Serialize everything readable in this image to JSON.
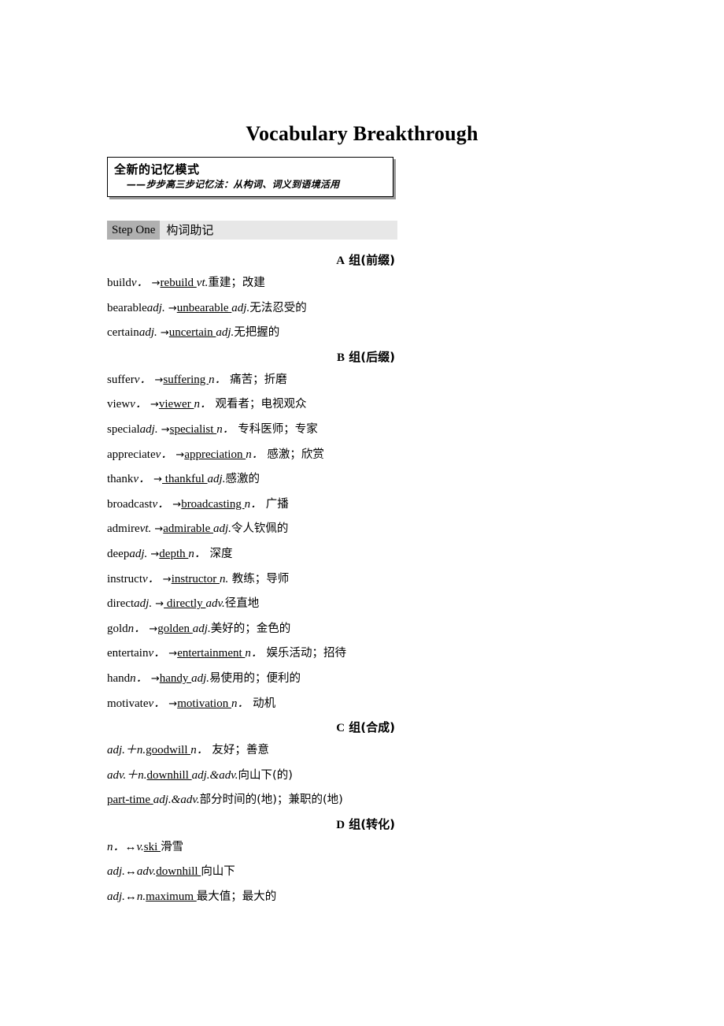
{
  "document": {
    "title": "Vocabulary Breakthrough"
  },
  "callout": {
    "title": "全新的记忆模式",
    "subtitle": "——步步高三步记忆法：从构词、词义到语境活用"
  },
  "step_bar": {
    "badge": "Step One",
    "label": "构词助记"
  },
  "groups": [
    {
      "heading_letter": "A",
      "heading_text": " 组(前缀)",
      "entries": [
        {
          "base": "build",
          "base_pos": "v．",
          "arrow": "→",
          "derived": "rebuild ",
          "derived_pos": "vt.",
          "meaning": "重建；改建"
        },
        {
          "base": "bearable",
          "base_pos": "adj.",
          "arrow": "→",
          "derived": "unbearable ",
          "derived_pos": "adj.",
          "meaning": "无法忍受的"
        },
        {
          "base": "certain",
          "base_pos": "adj.",
          "arrow": "→",
          "derived": "uncertain ",
          "derived_pos": "adj.",
          "meaning": "无把握的"
        }
      ]
    },
    {
      "heading_letter": "B",
      "heading_text": "  组(后缀)",
      "entries": [
        {
          "base": "suffer",
          "base_pos": "v．",
          "arrow": "→",
          "derived": "suffering ",
          "derived_pos": "n．",
          "meaning": " 痛苦；折磨"
        },
        {
          "base": "view",
          "base_pos": "v．",
          "arrow": "→",
          "derived": "viewer ",
          "derived_pos": "n．",
          "meaning": " 观看者；电视观众"
        },
        {
          "base": "special",
          "base_pos": "adj.",
          "arrow": "→",
          "derived": "specialist ",
          "derived_pos": "n．",
          "meaning": " 专科医师；专家"
        },
        {
          "base": "appreciate",
          "base_pos": "v．",
          "arrow": "→",
          "derived": "appreciation ",
          "derived_pos": "n．",
          "meaning": " 感激；欣赏"
        },
        {
          "base": "thank",
          "base_pos": "v．",
          "arrow": "→",
          "derived": " thankful ",
          "derived_pos": "adj.",
          "meaning": "感激的"
        },
        {
          "base": "broadcast",
          "base_pos": "v．",
          "arrow": "→",
          "derived": "broadcasting ",
          "derived_pos": "n．",
          "meaning": " 广播"
        },
        {
          "base": "admire",
          "base_pos": "vt.",
          "arrow": "→",
          "derived": "admirable ",
          "derived_pos": "adj.",
          "meaning": "令人钦佩的"
        },
        {
          "base": "deep",
          "base_pos": "adj.",
          "arrow": "→",
          "derived": "depth ",
          "derived_pos": "n．",
          "meaning": " 深度"
        },
        {
          "base": "instruct",
          "base_pos": "v．",
          "arrow": "→",
          "derived": "instructor ",
          "derived_pos": "n.",
          "meaning": " 教练；导师"
        },
        {
          "base": "direct",
          "base_pos": "adj.",
          "arrow": "→",
          "derived": " directly ",
          "derived_pos": "adv.",
          "meaning": "径直地"
        },
        {
          "base": "gold",
          "base_pos": "n．",
          "arrow": "→",
          "derived": "golden ",
          "derived_pos": "adj.",
          "meaning": "美好的；金色的"
        },
        {
          "base": "entertain",
          "base_pos": "v．",
          "arrow": "→",
          "derived": "entertainment ",
          "derived_pos": "n．",
          "meaning": " 娱乐活动；招待"
        },
        {
          "base": "hand",
          "base_pos": "n．",
          "arrow": "→",
          "derived": "handy ",
          "derived_pos": "adj.",
          "meaning": "易使用的；便利的"
        },
        {
          "base": "motivate",
          "base_pos": "v．",
          "arrow": "→",
          "derived": "motivation ",
          "derived_pos": "n．",
          "meaning": " 动机"
        }
      ]
    },
    {
      "heading_letter": "C",
      "heading_text": "  组(合成)",
      "entries": [
        {
          "formula": "adj.＋n.",
          "word": "goodwill ",
          "word_pos": "n．",
          "meaning": " 友好；善意"
        },
        {
          "formula": "adv.＋n.",
          "word": "downhill ",
          "word_pos": "adj.&adv.",
          "meaning": "向山下(的)"
        },
        {
          "formula": "",
          "word": "part-time ",
          "word_pos": "adj.&adv.",
          "meaning": "部分时间的(地)；兼职的(地)"
        }
      ]
    },
    {
      "heading_letter": "D",
      "heading_text": " 组(转化)",
      "entries": [
        {
          "formula": "n．↔v.",
          "word": "ski ",
          "word_pos": "",
          "meaning": "滑雪"
        },
        {
          "formula": "adj.↔adv.",
          "word": "downhill ",
          "word_pos": "",
          "meaning": "向山下"
        },
        {
          "formula": "adj.↔n.",
          "word": "maximum ",
          "word_pos": "",
          "meaning": "最大值；最大的"
        }
      ]
    }
  ]
}
